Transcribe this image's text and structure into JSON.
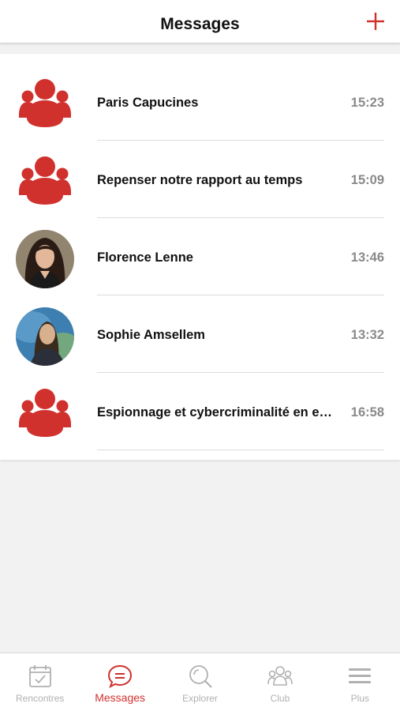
{
  "header": {
    "title": "Messages",
    "add_icon": "plus-icon"
  },
  "colors": {
    "accent": "#d0312d",
    "muted": "#b0b0b0",
    "time": "#8a8a8a"
  },
  "conversations": [
    {
      "title": "Paris Capucines",
      "time": "15:23",
      "avatar": "group-icon"
    },
    {
      "title": "Repenser notre rapport au temps",
      "time": "15:09",
      "avatar": "group-icon"
    },
    {
      "title": "Florence Lenne",
      "time": "13:46",
      "avatar": "person-photo"
    },
    {
      "title": "Sophie Amsellem",
      "time": "13:32",
      "avatar": "person-photo"
    },
    {
      "title": "Espionnage et cybercriminalité en en...",
      "time": "16:58",
      "avatar": "group-icon"
    }
  ],
  "tabbar": {
    "tabs": [
      {
        "label": "Rencontres",
        "icon": "calendar-check-icon"
      },
      {
        "label": "Messages",
        "icon": "chat-bubble-icon",
        "active": true
      },
      {
        "label": "Explorer",
        "icon": "search-icon"
      },
      {
        "label": "Club",
        "icon": "people-icon"
      },
      {
        "label": "Plus",
        "icon": "menu-icon"
      }
    ]
  }
}
